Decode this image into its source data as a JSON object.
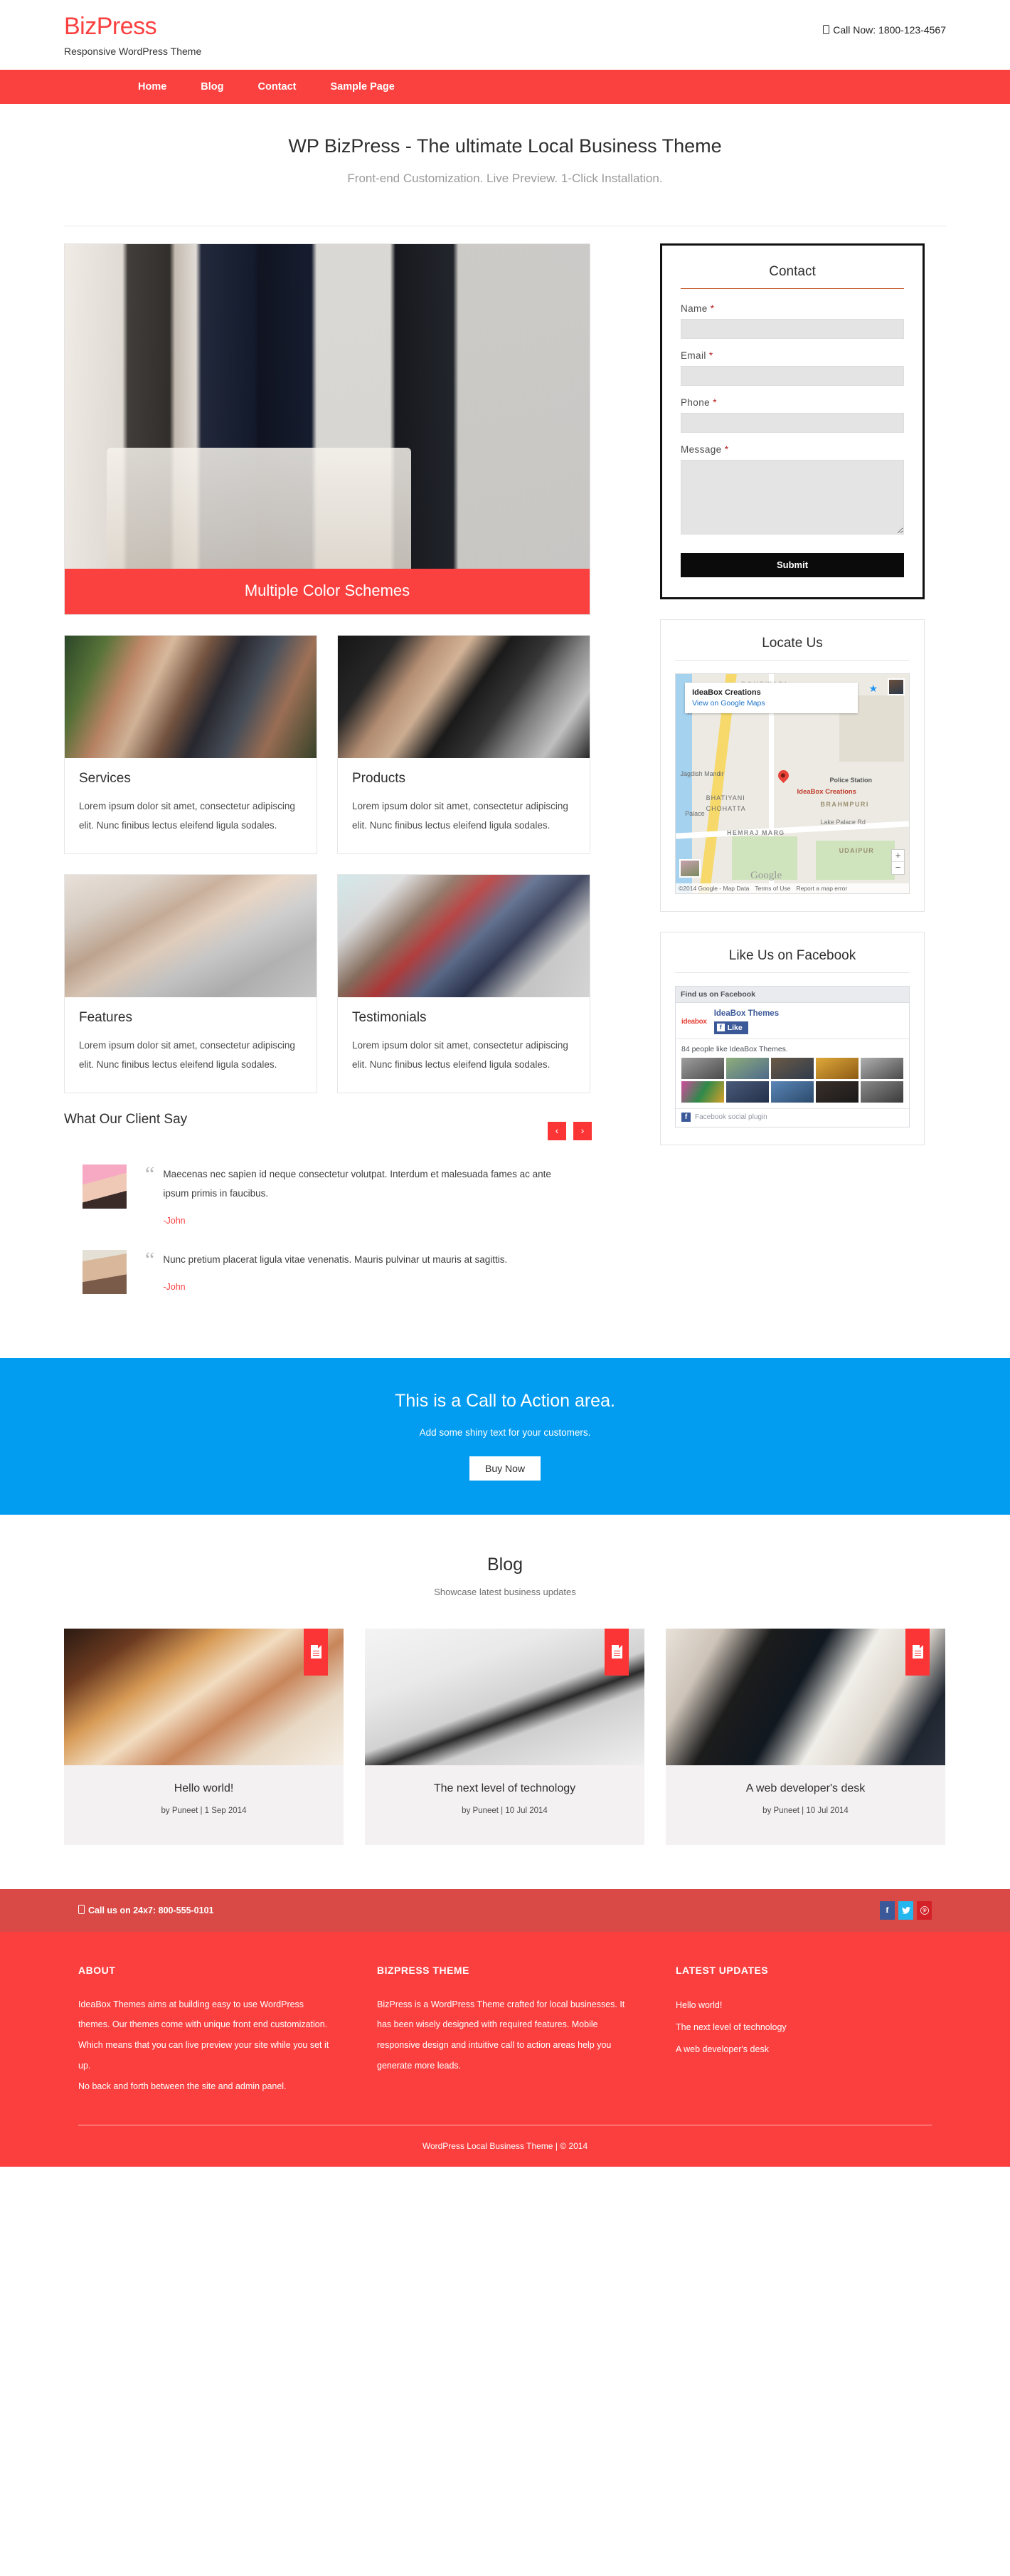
{
  "header": {
    "brand": "BizPress",
    "tagline": "Responsive WordPress Theme",
    "call_now": "Call Now: 1800-123-4567"
  },
  "nav": {
    "items": [
      {
        "label": "Home"
      },
      {
        "label": "Blog"
      },
      {
        "label": "Contact"
      },
      {
        "label": "Sample Page"
      }
    ]
  },
  "hero": {
    "title": "WP BizPress - The ultimate Local Business Theme",
    "subtitle": "Front-end Customization. Live Preview. 1-Click Installation."
  },
  "slider": {
    "caption": "Multiple Color Schemes"
  },
  "cards": [
    {
      "title": "Services",
      "text": "Lorem ipsum dolor sit amet, consectetur adipiscing elit. Nunc finibus lectus eleifend ligula sodales."
    },
    {
      "title": "Products",
      "text": "Lorem ipsum dolor sit amet, consectetur adipiscing elit. Nunc finibus lectus eleifend ligula sodales."
    },
    {
      "title": "Features",
      "text": "Lorem ipsum dolor sit amet, consectetur adipiscing elit. Nunc finibus lectus eleifend ligula sodales."
    },
    {
      "title": "Testimonials",
      "text": "Lorem ipsum dolor sit amet, consectetur adipiscing elit. Nunc finibus lectus eleifend ligula sodales."
    }
  ],
  "contact": {
    "title": "Contact",
    "name_label": "Name",
    "email_label": "Email",
    "phone_label": "Phone",
    "message_label": "Message",
    "required_mark": "*",
    "name_value": "",
    "email_value": "",
    "phone_value": "",
    "message_value": "",
    "submit_label": "Submit"
  },
  "locate": {
    "title": "Locate Us",
    "info_name": "IdeaBox Creations",
    "info_link": "View on Google Maps",
    "pin_label": "IdeaBox Creations",
    "labels": [
      "Jagdish Mandir",
      "BHATIYANI",
      "CHOHATTA",
      "Palace",
      "Police Station",
      "BRAHMPURI",
      "HEMRAJ MARG",
      "Lake Palace Rd",
      "UDAIPUR",
      "R",
      "BOHRWADI"
    ],
    "google_wordmark": "Google",
    "credit": "©2014 Google - Map Data",
    "terms": "Terms of Use",
    "report": "Report a map error",
    "zoom_in": "+",
    "zoom_out": "−"
  },
  "facebook": {
    "title": "Like Us on Facebook",
    "find_us": "Find us on Facebook",
    "logo_text": "ideabox",
    "page_name": "IdeaBox Themes",
    "like_label": "Like",
    "like_count_text": "84 people like IdeaBox Themes.",
    "plugin_label": "Facebook social plugin",
    "thumb_colors": [
      "#8d8d8d",
      "#7f9bb0",
      "#5b5f4e",
      "#c99a3e",
      "#8d8d8d",
      "#b0439a",
      "#3e4a6b",
      "#4a6fa5",
      "#2b2b2b",
      "#6f6f6f"
    ]
  },
  "testimonials": {
    "title": "What Our Client Say",
    "prev_icon": "‹",
    "next_icon": "›",
    "items": [
      {
        "text": "Maecenas nec sapien id neque consectetur volutpat. Interdum et malesuada fames ac ante ipsum primis in faucibus.",
        "author": "-John"
      },
      {
        "text": "Nunc pretium placerat ligula vitae venenatis. Mauris pulvinar ut mauris at sagittis.",
        "author": "-John"
      }
    ]
  },
  "cta": {
    "title": "This is a Call to Action area.",
    "subtitle": "Add some shiny text for your customers.",
    "button": "Buy Now"
  },
  "blog": {
    "title": "Blog",
    "subtitle": "Showcase latest business updates",
    "posts": [
      {
        "title": "Hello world!",
        "meta": "by Puneet  |  1 Sep 2014"
      },
      {
        "title": "The next level of technology",
        "meta": "by Puneet  |  10 Jul 2014"
      },
      {
        "title": "A web developer's desk",
        "meta": "by Puneet  |  10 Jul 2014"
      }
    ]
  },
  "footer": {
    "call_text": "Call us on 24x7: 800-555-0101",
    "social": [
      {
        "name": "facebook",
        "glyph": "f"
      },
      {
        "name": "twitter",
        "glyph": "🐦"
      },
      {
        "name": "pinterest",
        "glyph": "P"
      }
    ],
    "columns": [
      {
        "heading": "ABOUT",
        "paragraphs": [
          "IdeaBox Themes aims at building easy to use WordPress themes. Our themes come with unique front end customization. Which means that you can live preview your site while you set it up.",
          "No back and forth between the site and admin panel."
        ]
      },
      {
        "heading": "BIZPRESS THEME",
        "paragraphs": [
          "BizPress is a WordPress Theme crafted for local businesses. It has been wisely designed with required features. Mobile responsive design and intuitive call to action areas help you generate more leads."
        ]
      },
      {
        "heading": "LATEST UPDATES",
        "links": [
          "Hello world!",
          "The next level of technology",
          "A web developer's desk"
        ]
      }
    ],
    "copyright": "WordPress Local Business Theme | © 2014"
  },
  "colors": {
    "brand_red": "#fb4040",
    "cta_blue": "#029cf0",
    "footer_red": "#fb3f3f",
    "footer_top_red": "#d94a46"
  }
}
